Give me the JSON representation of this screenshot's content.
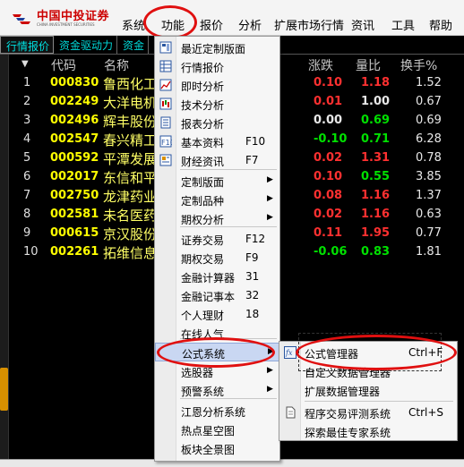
{
  "app": {
    "logo_cn": "中国中投证券",
    "logo_en": "CHINA INVESTMENT SECURITIES"
  },
  "menubar": [
    "系统",
    "功能",
    "报价",
    "分析",
    "扩展市场行情",
    "资讯",
    "工具",
    "帮助"
  ],
  "tabs": [
    "行情报价",
    "资金驱动力",
    "资金"
  ],
  "table": {
    "headers": [
      "代码",
      "名称",
      "涨跌",
      "量比",
      "换手%"
    ],
    "rows": [
      {
        "idx": "1",
        "code": "000830",
        "name": "鲁西化工",
        "chg": "0.10",
        "chg_color": "red",
        "vr": "1.18",
        "vr_color": "red",
        "turn": "1.52"
      },
      {
        "idx": "2",
        "code": "002249",
        "name": "大洋电机",
        "chg": "0.01",
        "chg_color": "red",
        "vr": "1.00",
        "vr_color": "white",
        "turn": "0.67"
      },
      {
        "idx": "3",
        "code": "002496",
        "name": "辉丰股份",
        "chg": "0.00",
        "chg_color": "white",
        "vr": "0.69",
        "vr_color": "green",
        "turn": "0.69"
      },
      {
        "idx": "4",
        "code": "002547",
        "name": "春兴精工",
        "chg": "-0.10",
        "chg_color": "green",
        "vr": "0.71",
        "vr_color": "green",
        "turn": "6.28"
      },
      {
        "idx": "5",
        "code": "000592",
        "name": "平潭发展",
        "chg": "0.02",
        "chg_color": "red",
        "vr": "1.31",
        "vr_color": "red",
        "turn": "0.78"
      },
      {
        "idx": "6",
        "code": "002017",
        "name": "东信和平",
        "chg": "0.10",
        "chg_color": "red",
        "vr": "0.55",
        "vr_color": "green",
        "turn": "3.85"
      },
      {
        "idx": "7",
        "code": "002750",
        "name": "龙津药业",
        "chg": "0.08",
        "chg_color": "red",
        "vr": "1.16",
        "vr_color": "red",
        "turn": "1.37"
      },
      {
        "idx": "8",
        "code": "002581",
        "name": "未名医药",
        "chg": "0.02",
        "chg_color": "red",
        "vr": "1.16",
        "vr_color": "red",
        "turn": "0.63"
      },
      {
        "idx": "9",
        "code": "000615",
        "name": "京汉股份",
        "chg": "0.11",
        "chg_color": "red",
        "vr": "1.95",
        "vr_color": "red",
        "turn": "0.77"
      },
      {
        "idx": "10",
        "code": "002261",
        "name": "拓维信息",
        "chg": "-0.06",
        "chg_color": "green",
        "vr": "0.83",
        "vr_color": "green",
        "turn": "1.81"
      }
    ]
  },
  "function_menu": {
    "items": [
      {
        "label": "最近定制版面",
        "shortcut": "",
        "submenu": false,
        "icon": "layout-icon"
      },
      {
        "label": "行情报价",
        "shortcut": "",
        "submenu": false,
        "icon": "table-icon"
      },
      {
        "label": "即时分析",
        "shortcut": "",
        "submenu": false,
        "icon": "line-chart-icon"
      },
      {
        "label": "技术分析",
        "shortcut": "",
        "submenu": false,
        "icon": "candlestick-icon"
      },
      {
        "label": "报表分析",
        "shortcut": "",
        "submenu": false,
        "icon": "report-icon"
      },
      {
        "label": "基本资料",
        "shortcut": "F10",
        "submenu": false,
        "icon": "f10-icon"
      },
      {
        "label": "财经资讯",
        "shortcut": "F7",
        "submenu": false,
        "icon": "news-icon"
      },
      {
        "label": "定制版面",
        "shortcut": "",
        "submenu": true,
        "icon": ""
      },
      {
        "label": "定制品种",
        "shortcut": "",
        "submenu": true,
        "icon": ""
      },
      {
        "label": "期权分析",
        "shortcut": "",
        "submenu": true,
        "icon": ""
      },
      {
        "label": "证券交易",
        "shortcut": "F12",
        "submenu": false,
        "icon": ""
      },
      {
        "label": "期权交易",
        "shortcut": "F9",
        "submenu": false,
        "icon": ""
      },
      {
        "label": "金融计算器",
        "shortcut": "31",
        "submenu": false,
        "icon": ""
      },
      {
        "label": "金融记事本",
        "shortcut": "32",
        "submenu": false,
        "icon": ""
      },
      {
        "label": "个人理财",
        "shortcut": "18",
        "submenu": false,
        "icon": ""
      },
      {
        "label": "在线人气",
        "shortcut": "",
        "submenu": false,
        "icon": ""
      },
      {
        "label": "公式系统",
        "shortcut": "",
        "submenu": true,
        "icon": ""
      },
      {
        "label": "选股器",
        "shortcut": "",
        "submenu": true,
        "icon": ""
      },
      {
        "label": "预警系统",
        "shortcut": "",
        "submenu": true,
        "icon": ""
      },
      {
        "label": "江恩分析系统",
        "shortcut": "",
        "submenu": false,
        "icon": ""
      },
      {
        "label": "热点星空图",
        "shortcut": "",
        "submenu": false,
        "icon": ""
      },
      {
        "label": "板块全景图",
        "shortcut": "",
        "submenu": false,
        "icon": ""
      }
    ]
  },
  "formula_submenu": {
    "items": [
      {
        "label": "公式管理器",
        "shortcut": "Ctrl+F",
        "icon": "fx-icon"
      },
      {
        "label": "自定义数据管理器",
        "shortcut": "",
        "icon": ""
      },
      {
        "label": "扩展数据管理器",
        "shortcut": "",
        "icon": ""
      },
      {
        "label": "程序交易评测系统",
        "shortcut": "Ctrl+S",
        "icon": "document-icon"
      },
      {
        "label": "探索最佳专家系统",
        "shortcut": "",
        "icon": ""
      }
    ]
  },
  "colors": {
    "quote_bg": "#000000",
    "code_yellow": "#ffff00",
    "up_red": "#ff3030",
    "down_green": "#00e000",
    "menu_highlight": "#c9d7f2",
    "annotation_red": "#e01010"
  }
}
